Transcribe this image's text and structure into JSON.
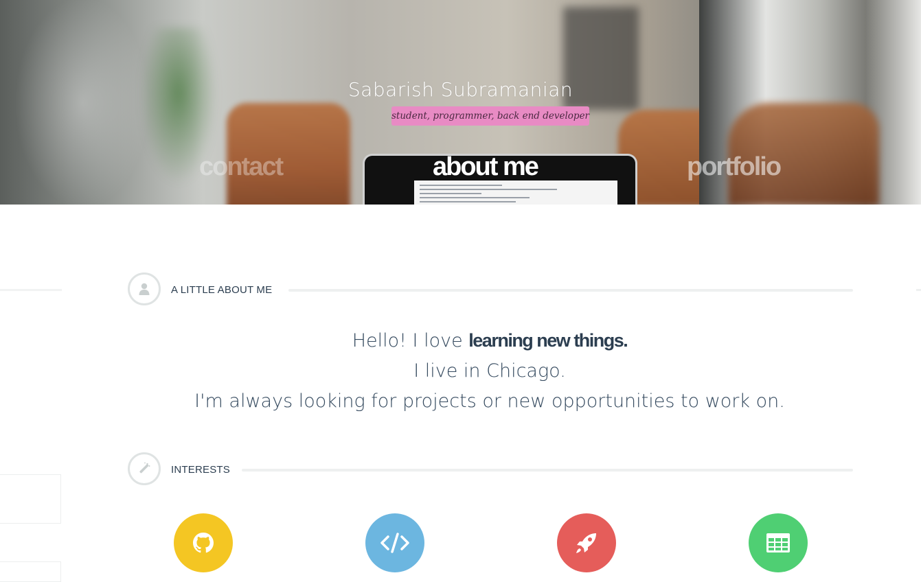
{
  "hero": {
    "name": "Sabarish Subramanian",
    "tagline": "student, programmer, back end developer",
    "nav": {
      "contact": "contact",
      "about": "about me",
      "portfolio": "portfolio"
    }
  },
  "about_section": {
    "title": "A LITTLE ABOUT ME",
    "icon": "user-icon",
    "line1_prefix": "Hello! I love",
    "line1_emphasis": "learning new things.",
    "line2": "I live in Chicago.",
    "line3": "I'm always looking for projects or new opportunities to work on."
  },
  "interests_section": {
    "title": "INTERESTS",
    "icon": "magic-wand-icon",
    "items": [
      {
        "icon": "github-icon",
        "color": "#f4c623"
      },
      {
        "icon": "code-icon",
        "color": "#6cb6e0"
      },
      {
        "icon": "rocket-icon",
        "color": "#e55d5a"
      },
      {
        "icon": "table-icon",
        "color": "#4fcf73"
      }
    ]
  },
  "colors": {
    "tagline_bg": "#e88bc4",
    "text": "#2c3e50",
    "rule": "#eef0f0"
  }
}
